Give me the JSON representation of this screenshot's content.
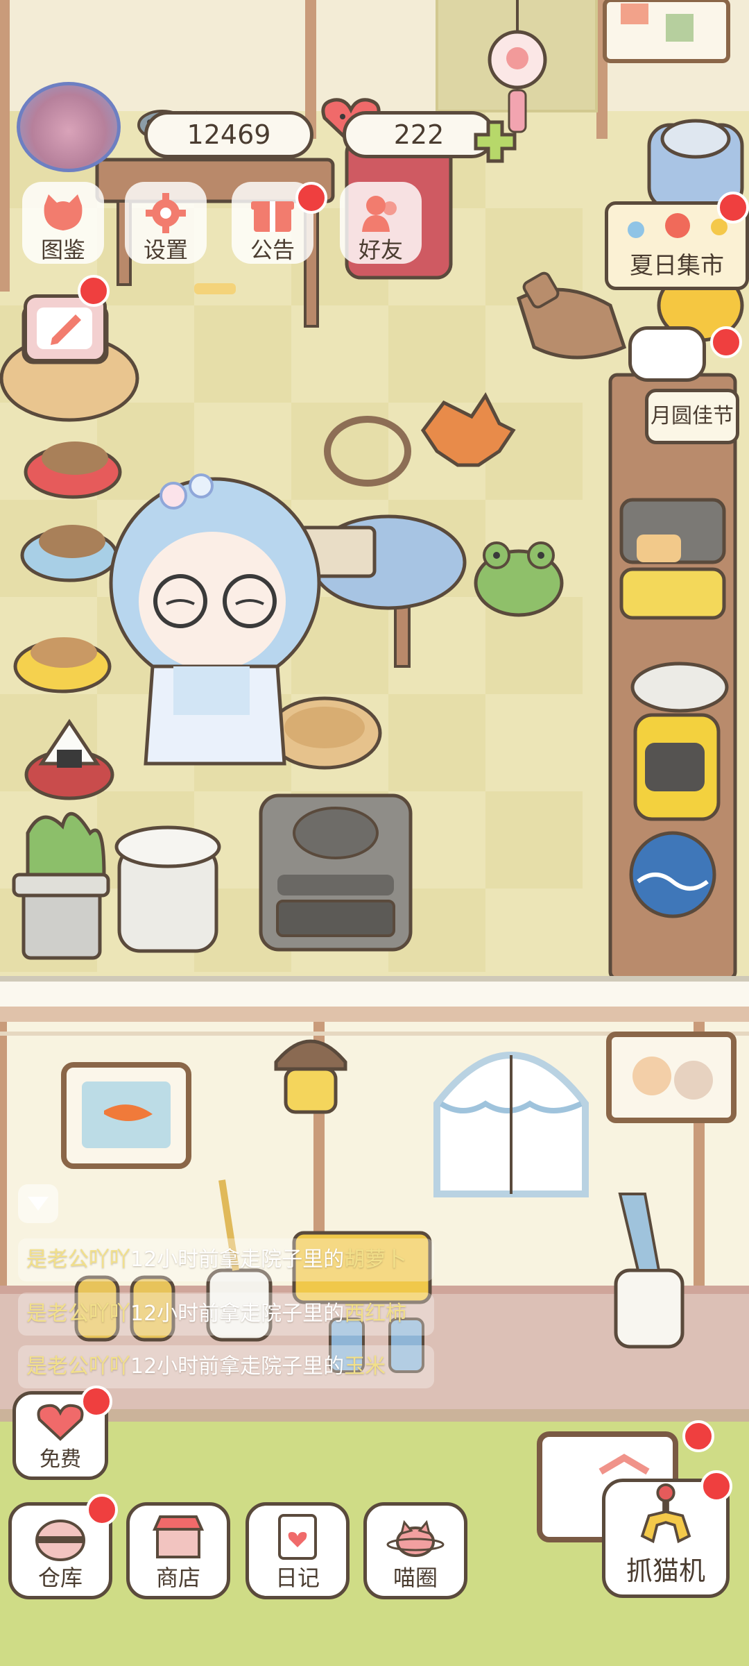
{
  "hud": {
    "fish_coins": "12469",
    "hearts": "222",
    "colors": {
      "badge": "#ef3f3f",
      "outline": "#5a4a3c",
      "accent_pink": "#f06a6a"
    }
  },
  "top_menu": [
    {
      "label": "图鉴",
      "icon": "cat-face-icon",
      "badge": false
    },
    {
      "label": "设置",
      "icon": "gear-icon",
      "badge": false
    },
    {
      "label": "公告",
      "icon": "gift-icon",
      "badge": true
    },
    {
      "label": "好友",
      "icon": "friends-icon",
      "badge": false
    }
  ],
  "events": {
    "summer_market": "夏日集市",
    "mid_autumn": "月圆佳节"
  },
  "activity_log": [
    {
      "who": "是老公吖吖",
      "text": "12小时前拿走院子里的",
      "item": "胡萝卜"
    },
    {
      "who": "是老公吖吖",
      "text": "12小时前拿走院子里的",
      "item": "西红柿"
    },
    {
      "who": "是老公吖吖",
      "text": "12小时前拿走院子里的",
      "item": "玉米"
    }
  ],
  "bottom": {
    "free": "免费",
    "warehouse": "仓库",
    "shop": "商店",
    "diary": "日记",
    "cat_circle": "喵圈",
    "claw_machine": "抓猫机"
  }
}
